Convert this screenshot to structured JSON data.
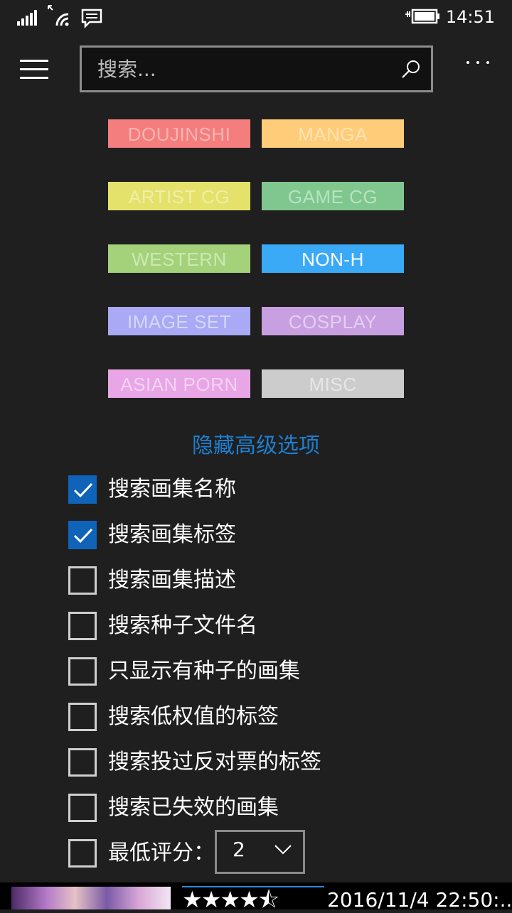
{
  "status_bar": {
    "time": "14:51",
    "icons": [
      "signal-icon",
      "wifi-icon",
      "message-icon",
      "battery-icon"
    ]
  },
  "search": {
    "placeholder": "搜索..."
  },
  "categories": [
    {
      "label": "DOUJINSHI",
      "bg": "#f47e7e",
      "fg": "#f8b4b4"
    },
    {
      "label": "MANGA",
      "bg": "#ffcc7a",
      "fg": "#ffe3b3"
    },
    {
      "label": "ARTIST CG",
      "bg": "#e4e26a",
      "fg": "#f0eea8"
    },
    {
      "label": "GAME CG",
      "bg": "#7fc78f",
      "fg": "#b8e3c2"
    },
    {
      "label": "WESTERN",
      "bg": "#a4d27a",
      "fg": "#cde8b4"
    },
    {
      "label": "NON-H",
      "bg": "#3aaaf7",
      "fg": "#ffffff"
    },
    {
      "label": "IMAGE SET",
      "bg": "#a9a9f5",
      "fg": "#d6d6fb"
    },
    {
      "label": "COSPLAY",
      "bg": "#c89fe0",
      "fg": "#e4cff0"
    },
    {
      "label": "ASIAN PORN",
      "bg": "#e8a6e6",
      "fg": "#f4d3f2"
    },
    {
      "label": "MISC",
      "bg": "#cccccc",
      "fg": "#e6e6e6"
    }
  ],
  "advanced_toggle": "隐藏高级选项",
  "options": [
    {
      "label": "搜索画集名称",
      "checked": true
    },
    {
      "label": "搜索画集标签",
      "checked": true
    },
    {
      "label": "搜索画集描述",
      "checked": false
    },
    {
      "label": "搜索种子文件名",
      "checked": false
    },
    {
      "label": "只显示有种子的画集",
      "checked": false
    },
    {
      "label": "搜索低权值的标签",
      "checked": false
    },
    {
      "label": "搜索投过反对票的标签",
      "checked": false
    },
    {
      "label": "搜索已失效的画集",
      "checked": false
    },
    {
      "label": "最低评分：",
      "checked": false
    }
  ],
  "min_rating_select": {
    "value": "2"
  },
  "result_preview": {
    "stars": "★★★★⯪",
    "rating": 4.5,
    "date": "2016/11/4 22:50:..."
  },
  "colors": {
    "accent": "#0f63b8",
    "link": "#1e7fd0",
    "background": "#1f1f1f"
  }
}
